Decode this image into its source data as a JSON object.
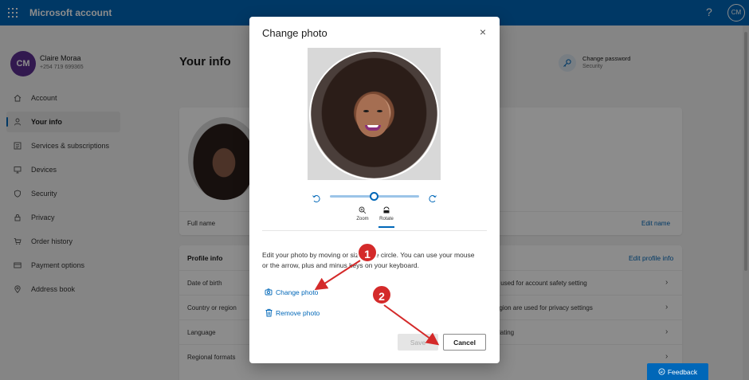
{
  "header": {
    "brand": "Microsoft account",
    "help": "?",
    "avatar_initials": "CM"
  },
  "user": {
    "initials": "CM",
    "name": "Claire Moraa",
    "phone": "+254 719 699365"
  },
  "sidebar": {
    "items": [
      {
        "label": "Account",
        "icon": "home-icon",
        "active": false
      },
      {
        "label": "Your info",
        "icon": "person-icon",
        "active": true
      },
      {
        "label": "Services & subscriptions",
        "icon": "list-icon",
        "active": false
      },
      {
        "label": "Devices",
        "icon": "monitor-icon",
        "active": false
      },
      {
        "label": "Security",
        "icon": "shield-icon",
        "active": false
      },
      {
        "label": "Privacy",
        "icon": "lock-icon",
        "active": false
      },
      {
        "label": "Order history",
        "icon": "cart-icon",
        "active": false
      },
      {
        "label": "Payment options",
        "icon": "card-icon",
        "active": false
      },
      {
        "label": "Address book",
        "icon": "pin-icon",
        "active": false
      }
    ]
  },
  "main": {
    "title": "Your info",
    "change_password": {
      "title": "Change password",
      "subtitle": "Security"
    },
    "full_name_label": "Full name",
    "edit_name": "Edit name",
    "profile_info": {
      "title": "Profile info",
      "edit": "Edit profile info",
      "rows": [
        {
          "label": "Date of birth",
          "value": "s used for account safety setting"
        },
        {
          "label": "Country or region",
          "value": "egion are used for privacy settings"
        },
        {
          "label": "Language",
          "value": "slating"
        },
        {
          "label": "Regional formats",
          "value": ""
        }
      ]
    }
  },
  "dialog": {
    "title": "Change photo",
    "zoom_label": "Zoom",
    "rotate_label": "Rotate",
    "slider_value": 0.5,
    "instructions": "Edit your photo by moving or sizing the circle. You can use your mouse or the arrow, plus and minus keys on your keyboard.",
    "change_photo": "Change photo",
    "remove_photo": "Remove photo",
    "save": "Save",
    "cancel": "Cancel"
  },
  "annotations": {
    "marker_1": "1",
    "marker_2": "2",
    "color": "#d42a2a"
  },
  "feedback": "Feedback",
  "colors": {
    "brand": "#0067b8",
    "avatar": "#5c2e91",
    "marker": "#d42a2a"
  }
}
